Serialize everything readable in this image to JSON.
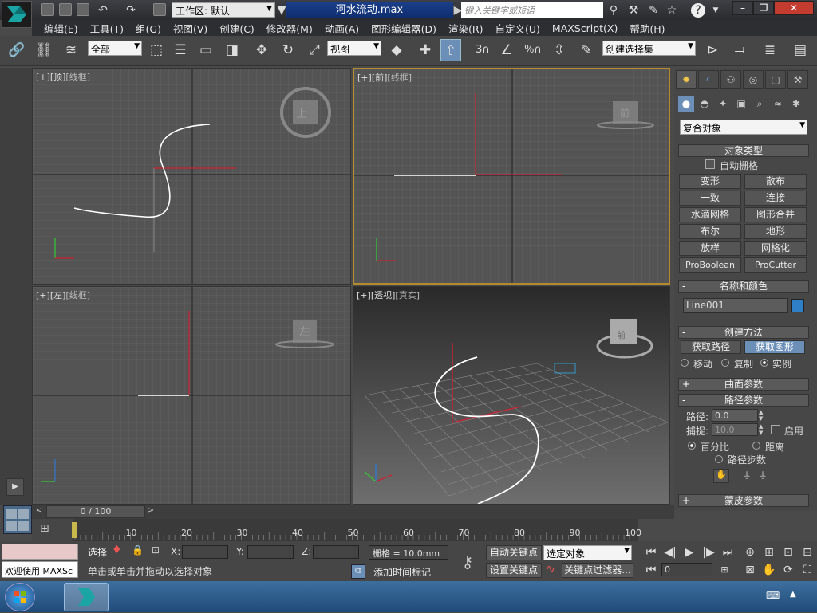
{
  "titlebar": {
    "workspace_label": "工作区: 默认",
    "document_title": "河水流动.max",
    "search_placeholder": "键入关键字或短语"
  },
  "menu": [
    "编辑(E)",
    "工具(T)",
    "组(G)",
    "视图(V)",
    "创建(C)",
    "修改器(M)",
    "动画(A)",
    "图形编辑器(D)",
    "渲染(R)",
    "自定义(U)",
    "MAXScript(X)",
    "帮助(H)"
  ],
  "toolbar": {
    "selection_filter": "全部",
    "reference_coord": "视图",
    "named_selection": "创建选择集",
    "snap_3": "3",
    "percent_snap": "%"
  },
  "viewports": {
    "top": {
      "bracket1": "[+]",
      "name": "[顶]",
      "shading": "[线框]",
      "cube_label": "上"
    },
    "front": {
      "bracket1": "[+]",
      "name": "[前]",
      "shading": "[线框]",
      "cube_label": "前"
    },
    "left": {
      "bracket1": "[+]",
      "name": "[左]",
      "shading": "[线框]",
      "cube_label": "左"
    },
    "perspective": {
      "bracket1": "[+]",
      "name": "[透视]",
      "shading": "[真实]",
      "cube_label": "前"
    }
  },
  "command_panel": {
    "category": "复合对象",
    "object_type_title": "对象类型",
    "autogrid": "自动栅格",
    "buttons": [
      "变形",
      "散布",
      "一致",
      "连接",
      "水滴网格",
      "图形合并",
      "布尔",
      "地形",
      "放样",
      "网格化",
      "ProBoolean",
      "ProCutter"
    ],
    "name_color_title": "名称和颜色",
    "object_name": "Line001",
    "color": "#2f7fc6",
    "creation_method_title": "创建方法",
    "get_path": "获取路径",
    "get_shape": "获取图形",
    "radio_move": "移动",
    "radio_copy": "复制",
    "radio_instance": "实例",
    "surface_params_title": "曲面参数",
    "path_params_title": "路径参数",
    "path_label": "路径:",
    "path_value": "0.0",
    "snap_label": "捕捉:",
    "snap_value": "10.0",
    "enable_label": "启用",
    "percent_label": "百分比",
    "distance_label": "距离",
    "path_steps_label": "路径步数",
    "skin_params_title": "蒙皮参数"
  },
  "time_slider": {
    "value": "0 / 100"
  },
  "trackbar": {
    "ticks": [
      "0",
      "10",
      "20",
      "30",
      "40",
      "50",
      "60",
      "70",
      "80",
      "90",
      "100"
    ]
  },
  "status": {
    "maxscript_welcome": "欢迎使用 MAXSc",
    "select_label": "选择",
    "x_label": "X:",
    "y_label": "Y:",
    "z_label": "Z:",
    "grid_label": "栅格 = 10.0mm",
    "prompt": "单击或单击并拖动以选择对象",
    "add_time_tag": "添加时间标记",
    "auto_key": "自动关键点",
    "set_key": "设置关键点",
    "key_mode": "选定对象",
    "key_filters": "关键点过滤器...",
    "frame": "0"
  }
}
